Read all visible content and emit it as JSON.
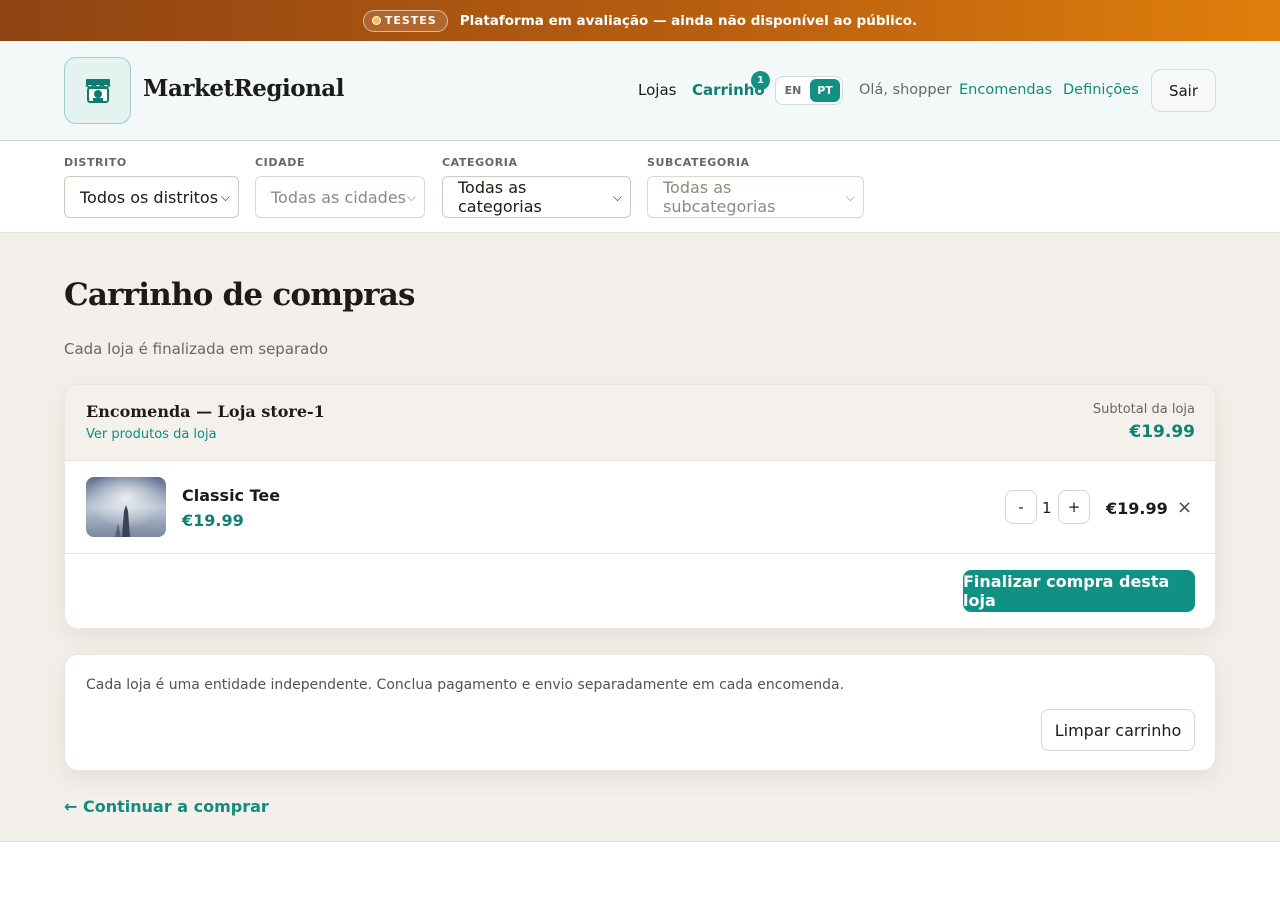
{
  "banner": {
    "badge": "TESTES",
    "text": "Plataforma em avaliação — ainda não disponível ao público."
  },
  "header": {
    "brand": "MarketRegional",
    "nav": {
      "stores": "Lojas",
      "cart": "Carrinho",
      "cart_count": "1",
      "lang_en": "EN",
      "lang_pt": "PT",
      "active_lang": "PT",
      "greeting": "Olá, shopper",
      "orders": "Encomendas",
      "settings": "Definições",
      "logout": "Sair"
    }
  },
  "filters": [
    {
      "label": "DISTRITO",
      "value": "Todos os distritos",
      "enabled": true
    },
    {
      "label": "CIDADE",
      "value": "Todas as cidades",
      "enabled": false
    },
    {
      "label": "CATEGORIA",
      "value": "Todas as categorias",
      "enabled": true
    },
    {
      "label": "SUBCATEGORIA",
      "value": "Todas as subcategorias",
      "enabled": false
    }
  ],
  "page": {
    "title": "Carrinho de compras",
    "subtitle": "Cada loja é finalizada em separado"
  },
  "order": {
    "title": "Encomenda — Loja store-1",
    "view_products": "Ver produtos da loja",
    "subtotal_label": "Subtotal da loja",
    "subtotal_value": "€19.99",
    "items": [
      {
        "name": "Classic Tee",
        "unit_price": "€19.99",
        "quantity": "1",
        "minus": "-",
        "plus": "+",
        "line_total": "€19.99",
        "remove": "×"
      }
    ],
    "checkout": "Finalizar compra desta loja"
  },
  "info": {
    "text": "Cada loja é uma entidade independente. Conclua pagamento e envio separadamente em cada encomenda.",
    "clear": "Limpar carrinho"
  },
  "continue_shopping": "← Continuar a comprar",
  "colors": {
    "accent": "#119184",
    "accent_text": "#117f73",
    "banner_start": "#8f4413",
    "banner_end": "#e07f0c",
    "page_bg": "#f3f0eb"
  }
}
